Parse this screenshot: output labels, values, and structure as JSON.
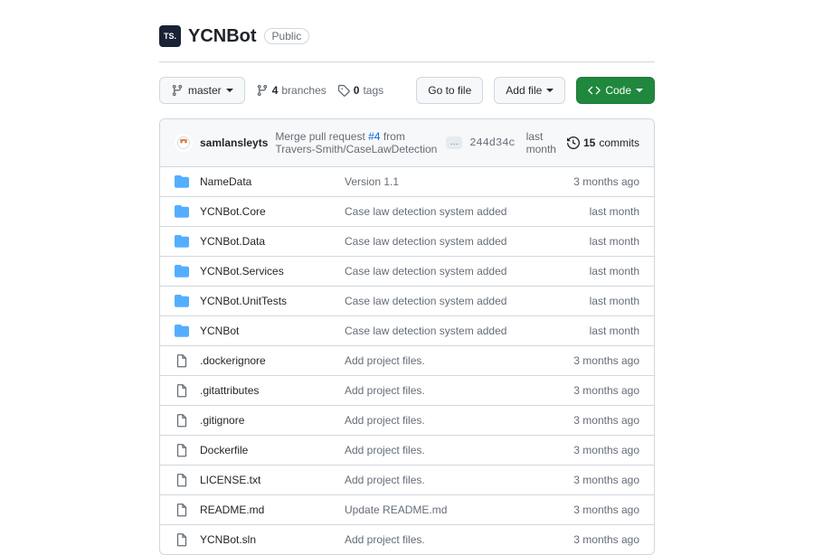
{
  "header": {
    "org_abbr": "TS.",
    "repo_name": "YCNBot",
    "visibility": "Public"
  },
  "actions": {
    "branch": "master",
    "branches_count": "4",
    "branches_label": "branches",
    "tags_count": "0",
    "tags_label": "tags",
    "go_to_file": "Go to file",
    "add_file": "Add file",
    "code": "Code"
  },
  "commit_bar": {
    "author": "samlansleyts",
    "msg_prefix": "Merge pull request",
    "msg_link": "#4",
    "msg_suffix": "from Travers-Smith/CaseLawDetection",
    "sha": "244d34c",
    "time": "last month",
    "commits_count": "15",
    "commits_label": "commits"
  },
  "files": [
    {
      "type": "dir",
      "name": "NameData",
      "msg": "Version 1.1",
      "age": "3 months ago"
    },
    {
      "type": "dir",
      "name": "YCNBot.Core",
      "msg": "Case law detection system added",
      "age": "last month"
    },
    {
      "type": "dir",
      "name": "YCNBot.Data",
      "msg": "Case law detection system added",
      "age": "last month"
    },
    {
      "type": "dir",
      "name": "YCNBot.Services",
      "msg": "Case law detection system added",
      "age": "last month"
    },
    {
      "type": "dir",
      "name": "YCNBot.UnitTests",
      "msg": "Case law detection system added",
      "age": "last month"
    },
    {
      "type": "dir",
      "name": "YCNBot",
      "msg": "Case law detection system added",
      "age": "last month"
    },
    {
      "type": "file",
      "name": ".dockerignore",
      "msg": "Add project files.",
      "age": "3 months ago"
    },
    {
      "type": "file",
      "name": ".gitattributes",
      "msg": "Add project files.",
      "age": "3 months ago"
    },
    {
      "type": "file",
      "name": ".gitignore",
      "msg": "Add project files.",
      "age": "3 months ago"
    },
    {
      "type": "file",
      "name": "Dockerfile",
      "msg": "Add project files.",
      "age": "3 months ago"
    },
    {
      "type": "file",
      "name": "LICENSE.txt",
      "msg": "Add project files.",
      "age": "3 months ago"
    },
    {
      "type": "file",
      "name": "README.md",
      "msg": "Update README.md",
      "age": "3 months ago"
    },
    {
      "type": "file",
      "name": "YCNBot.sln",
      "msg": "Add project files.",
      "age": "3 months ago"
    }
  ]
}
